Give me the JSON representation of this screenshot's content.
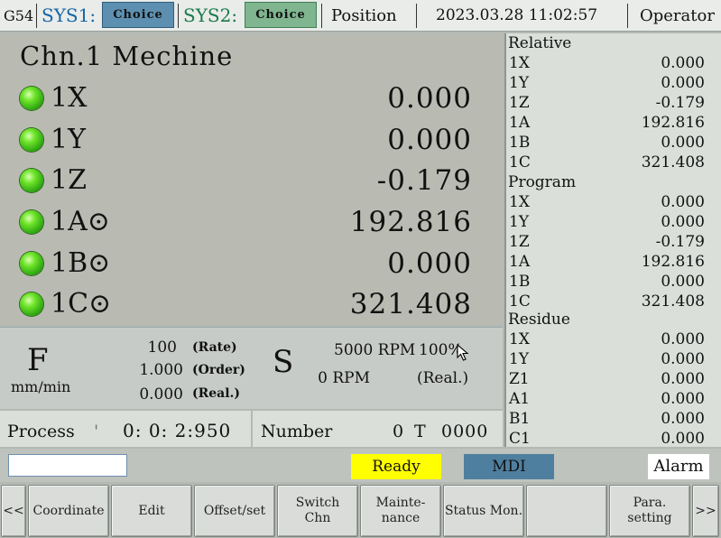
{
  "topbar": {
    "coord_system": "G54",
    "sys1_label": "SYS1:",
    "sys1_button": "Choice",
    "sys2_label": "SYS2:",
    "sys2_button": "Choice",
    "page_title": "Position",
    "datetime": "2023.03.28 11:02:57",
    "user": "Operator"
  },
  "machine": {
    "title": "Chn.1 Mechine",
    "axes": [
      {
        "name": "1X",
        "value": "0.000"
      },
      {
        "name": "1Y",
        "value": "0.000"
      },
      {
        "name": "1Z",
        "value": "-0.179"
      },
      {
        "name": "1A⊙",
        "value": "192.816"
      },
      {
        "name": "1B⊙",
        "value": "0.000"
      },
      {
        "name": "1C⊙",
        "value": "321.408"
      }
    ]
  },
  "relative": {
    "title": "Relative",
    "rows": [
      {
        "k": "1X",
        "v": "0.000"
      },
      {
        "k": "1Y",
        "v": "0.000"
      },
      {
        "k": "1Z",
        "v": "-0.179"
      },
      {
        "k": "1A",
        "v": "192.816"
      },
      {
        "k": "1B",
        "v": "0.000"
      },
      {
        "k": "1C",
        "v": "321.408"
      }
    ]
  },
  "program": {
    "title": "Program",
    "rows": [
      {
        "k": "1X",
        "v": "0.000"
      },
      {
        "k": "1Y",
        "v": "0.000"
      },
      {
        "k": "1Z",
        "v": "-0.179"
      },
      {
        "k": "1A",
        "v": "192.816"
      },
      {
        "k": "1B",
        "v": "0.000"
      },
      {
        "k": "1C",
        "v": "321.408"
      }
    ]
  },
  "residue": {
    "title": "Residue",
    "rows": [
      {
        "k": "1X",
        "v": "0.000"
      },
      {
        "k": "1Y",
        "v": "0.000"
      },
      {
        "k": "Z1",
        "v": "0.000"
      },
      {
        "k": "A1",
        "v": "0.000"
      },
      {
        "k": "B1",
        "v": "0.000"
      },
      {
        "k": "C1",
        "v": "0.000"
      }
    ]
  },
  "feed": {
    "letter": "F",
    "unit": "mm/min",
    "rate_value": "100",
    "rate_tag": "(Rate)",
    "order_value": "1.000",
    "order_tag": "(Order)",
    "real_value": "0.000",
    "real_tag": "(Real.)"
  },
  "spindle": {
    "letter": "S",
    "set_rpm": "5000 RPM",
    "override": "100%",
    "real_rpm": "0 RPM",
    "real_tag": "(Real.)"
  },
  "process": {
    "label": "Process",
    "time": "0: 0: 2:950"
  },
  "number": {
    "label": "Number",
    "value": "0",
    "t_label": "T",
    "t_value": "0000"
  },
  "statusbar": {
    "input_value": "",
    "ready": "Ready",
    "mode": "MDI",
    "alarm": "Alarm"
  },
  "softkeys": {
    "prev": "<<",
    "next": ">>",
    "keys": [
      "Coordinate",
      "Edit",
      "Offset/set",
      "Switch\nChn",
      "Mainte-\nnance",
      "Status Mon.",
      "",
      "Para.\nsetting"
    ]
  },
  "colors": {
    "ready_bg": "#ffff00",
    "mode_bg": "#4f7f9f",
    "choice_sys1": "#5d8fb0",
    "choice_sys2": "#7fb58f",
    "led_green": "#44c41a"
  }
}
